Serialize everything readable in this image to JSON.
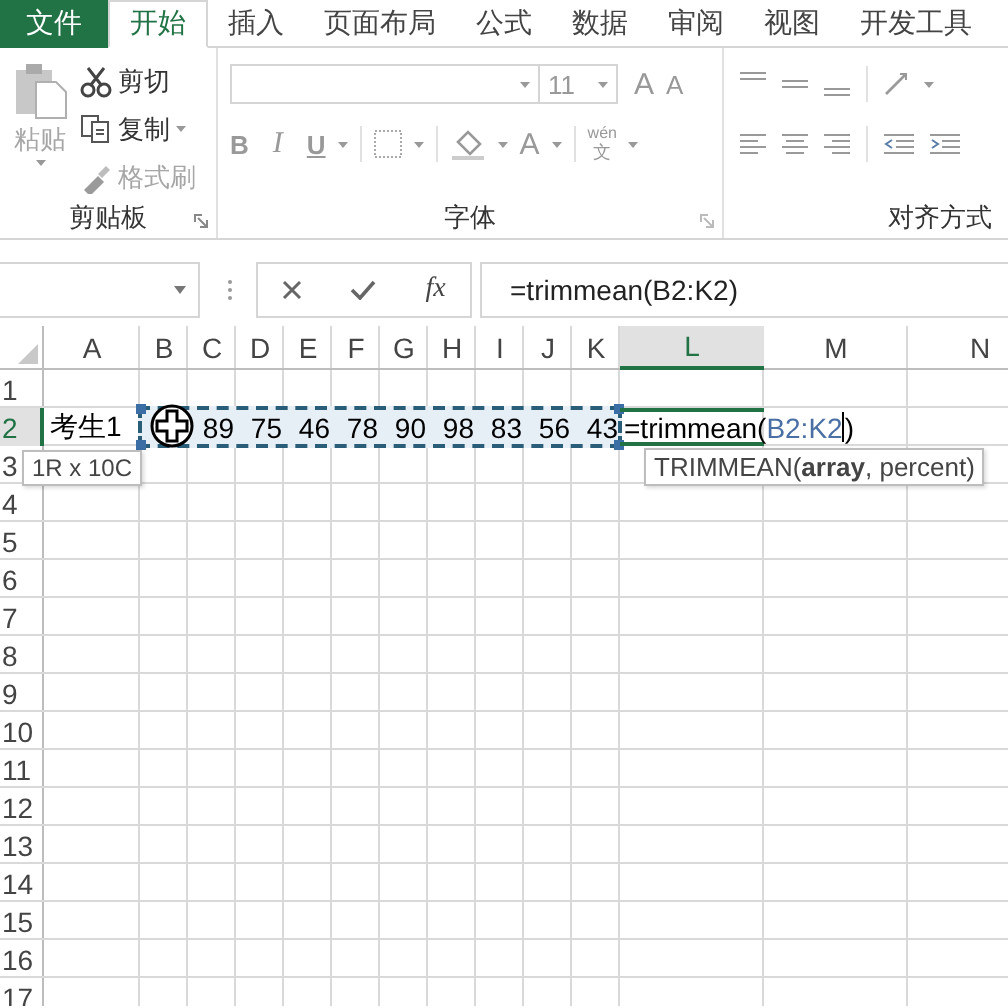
{
  "tabs": [
    {
      "label": "文件",
      "kind": "file",
      "selected": false
    },
    {
      "label": "开始",
      "kind": "tab",
      "selected": true
    },
    {
      "label": "插入",
      "kind": "tab",
      "selected": false
    },
    {
      "label": "页面布局",
      "kind": "tab",
      "selected": false
    },
    {
      "label": "公式",
      "kind": "tab",
      "selected": false
    },
    {
      "label": "数据",
      "kind": "tab",
      "selected": false
    },
    {
      "label": "审阅",
      "kind": "tab",
      "selected": false
    },
    {
      "label": "视图",
      "kind": "tab",
      "selected": false
    },
    {
      "label": "开发工具",
      "kind": "tab",
      "selected": false
    }
  ],
  "ribbon": {
    "clipboard": {
      "paste": {
        "label": "粘贴",
        "disabled": true
      },
      "items": [
        {
          "label": "剪切",
          "kind": "cut",
          "disabled": false
        },
        {
          "label": "复制",
          "kind": "copy",
          "disabled": false
        },
        {
          "label": "格式刷",
          "kind": "painter",
          "disabled": true
        }
      ],
      "label": "剪贴板"
    },
    "font": {
      "font_size": "11",
      "grow": "A",
      "shrink": "A",
      "bold": "B",
      "italic": "I",
      "underline": "U",
      "font_color": "A",
      "phonetic_top": "wén",
      "phonetic_bottom": "文",
      "label": "字体"
    },
    "alignment": {
      "label": "对齐方式"
    }
  },
  "formula_bar": {
    "insert_function": "fx",
    "formula": "=trimmean(B2:K2)"
  },
  "sheet": {
    "columns": [
      {
        "label": "A",
        "selected": false
      },
      {
        "label": "B",
        "selected": false
      },
      {
        "label": "C",
        "selected": false
      },
      {
        "label": "D",
        "selected": false
      },
      {
        "label": "E",
        "selected": false
      },
      {
        "label": "F",
        "selected": false
      },
      {
        "label": "G",
        "selected": false
      },
      {
        "label": "H",
        "selected": false
      },
      {
        "label": "I",
        "selected": false
      },
      {
        "label": "J",
        "selected": false
      },
      {
        "label": "K",
        "selected": false
      },
      {
        "label": "L",
        "selected": true
      },
      {
        "label": "M",
        "selected": false
      },
      {
        "label": "N",
        "selected": false
      }
    ],
    "rows": [
      {
        "label": "1",
        "selected": false
      },
      {
        "label": "2",
        "selected": true
      },
      {
        "label": "3",
        "selected": false
      },
      {
        "label": "4",
        "selected": false
      },
      {
        "label": "5",
        "selected": false
      },
      {
        "label": "6",
        "selected": false
      },
      {
        "label": "7",
        "selected": false
      },
      {
        "label": "8",
        "selected": false
      },
      {
        "label": "9",
        "selected": false
      },
      {
        "label": "10",
        "selected": false
      },
      {
        "label": "11",
        "selected": false
      },
      {
        "label": "12",
        "selected": false
      },
      {
        "label": "13",
        "selected": false
      },
      {
        "label": "14",
        "selected": false
      },
      {
        "label": "15",
        "selected": false
      },
      {
        "label": "16",
        "selected": false
      },
      {
        "label": "17",
        "selected": false
      }
    ],
    "data_row": {
      "name": "考生1",
      "scores": [
        "89",
        "75",
        "46",
        "78",
        "90",
        "98",
        "83",
        "56",
        "43"
      ]
    },
    "editing_cell": {
      "parts": [
        {
          "text": "=trimmean(",
          "kind": "plain"
        },
        {
          "text": "B2:K2",
          "kind": "ref"
        },
        {
          "text": ")",
          "kind": "plain"
        }
      ]
    },
    "selection_tooltip": "1R x 10C",
    "function_tooltip": "TRIMMEAN(**array**, percent)"
  }
}
